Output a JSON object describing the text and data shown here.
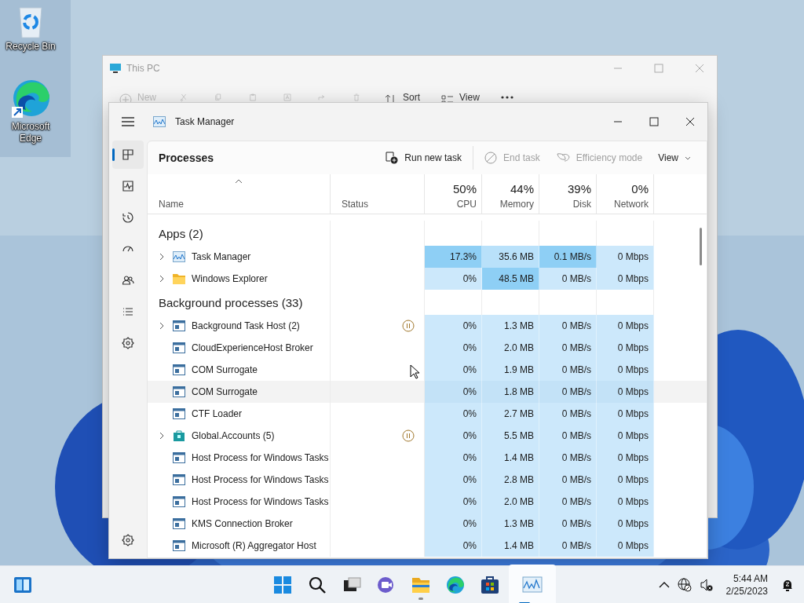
{
  "desktop_icons": [
    {
      "label": "Recycle Bin",
      "kind": "recycle"
    },
    {
      "label": "Microsoft Edge",
      "kind": "edge"
    }
  ],
  "explorer": {
    "title": "This PC",
    "toolbar": [
      {
        "kind": "new",
        "label": "New"
      },
      {
        "kind": "cut"
      },
      {
        "kind": "copy"
      },
      {
        "kind": "paste"
      },
      {
        "kind": "rename"
      },
      {
        "kind": "share"
      },
      {
        "kind": "delete"
      },
      {
        "kind": "sort",
        "label": "Sort"
      },
      {
        "kind": "view",
        "label": "View"
      }
    ]
  },
  "task_manager": {
    "title": "Task Manager",
    "nav": [
      {
        "kind": "processes",
        "selected": true
      },
      {
        "kind": "performance",
        "selected": false
      },
      {
        "kind": "history",
        "selected": false
      },
      {
        "kind": "startup",
        "selected": false
      },
      {
        "kind": "users",
        "selected": false
      },
      {
        "kind": "details",
        "selected": false
      },
      {
        "kind": "services",
        "selected": false
      }
    ],
    "page_title": "Processes",
    "actions": [
      {
        "kind": "run",
        "label": "Run new task",
        "disabled": false
      },
      {
        "kind": "end",
        "label": "End task",
        "disabled": true
      },
      {
        "kind": "efficiency",
        "label": "Efficiency mode",
        "disabled": true
      },
      {
        "kind": "menu",
        "label": "View",
        "disabled": false
      }
    ],
    "columns": [
      {
        "label": "Name",
        "sorted": true
      },
      {
        "label": "Status",
        "sorted": false
      },
      {
        "label": "CPU",
        "total": "50%",
        "sorted": false
      },
      {
        "label": "Memory",
        "total": "44%",
        "sorted": false
      },
      {
        "label": "Disk",
        "total": "39%",
        "sorted": false
      },
      {
        "label": "Network",
        "total": "0%",
        "sorted": false
      }
    ],
    "groups": [
      {
        "title": "Apps (2)",
        "rows": [
          {
            "name": "Task Manager",
            "kind": "chart",
            "expandable": true,
            "suspended": false,
            "hovered": false,
            "cells": [
              {
                "text": "17.3%",
                "color": "#8ecff5"
              },
              {
                "text": "35.6 MB",
                "color": "#b9e1fa"
              },
              {
                "text": "0.1 MB/s",
                "color": "#8ecff5"
              },
              {
                "text": "0 Mbps",
                "color": "#cce8fb"
              }
            ]
          },
          {
            "name": "Windows Explorer",
            "kind": "folder",
            "expandable": true,
            "suspended": false,
            "hovered": false,
            "cells": [
              {
                "text": "0%",
                "color": "#cce8fb"
              },
              {
                "text": "48.5 MB",
                "color": "#8ecff5"
              },
              {
                "text": "0 MB/s",
                "color": "#cce8fb"
              },
              {
                "text": "0 Mbps",
                "color": "#cce8fb"
              }
            ]
          }
        ]
      },
      {
        "title": "Background processes (33)",
        "rows": [
          {
            "name": "Background Task Host (2)",
            "kind": "window",
            "expandable": true,
            "suspended": true,
            "hovered": false,
            "cells": [
              {
                "text": "0%",
                "color": "#cce8fb"
              },
              {
                "text": "1.3 MB",
                "color": "#cce8fb"
              },
              {
                "text": "0 MB/s",
                "color": "#cce8fb"
              },
              {
                "text": "0 Mbps",
                "color": "#cce8fb"
              }
            ]
          },
          {
            "name": "CloudExperienceHost Broker",
            "kind": "window",
            "expandable": false,
            "suspended": false,
            "hovered": false,
            "cells": [
              {
                "text": "0%",
                "color": "#cce8fb"
              },
              {
                "text": "2.0 MB",
                "color": "#cce8fb"
              },
              {
                "text": "0 MB/s",
                "color": "#cce8fb"
              },
              {
                "text": "0 Mbps",
                "color": "#cce8fb"
              }
            ]
          },
          {
            "name": "COM Surrogate",
            "kind": "window",
            "expandable": false,
            "suspended": false,
            "hovered": false,
            "cells": [
              {
                "text": "0%",
                "color": "#cce8fb"
              },
              {
                "text": "1.9 MB",
                "color": "#cce8fb"
              },
              {
                "text": "0 MB/s",
                "color": "#cce8fb"
              },
              {
                "text": "0 Mbps",
                "color": "#cce8fb"
              }
            ]
          },
          {
            "name": "COM Surrogate",
            "kind": "window",
            "expandable": false,
            "suspended": false,
            "hovered": true,
            "cells": [
              {
                "text": "0%",
                "color": "#c3e2f7"
              },
              {
                "text": "1.8 MB",
                "color": "#c3e2f7"
              },
              {
                "text": "0 MB/s",
                "color": "#c3e2f7"
              },
              {
                "text": "0 Mbps",
                "color": "#c3e2f7"
              }
            ]
          },
          {
            "name": "CTF Loader",
            "kind": "window",
            "expandable": false,
            "suspended": false,
            "hovered": false,
            "cells": [
              {
                "text": "0%",
                "color": "#cce8fb"
              },
              {
                "text": "2.7 MB",
                "color": "#cce8fb"
              },
              {
                "text": "0 MB/s",
                "color": "#cce8fb"
              },
              {
                "text": "0 Mbps",
                "color": "#cce8fb"
              }
            ]
          },
          {
            "name": "Global.Accounts (5)",
            "kind": "store",
            "expandable": true,
            "suspended": true,
            "hovered": false,
            "cells": [
              {
                "text": "0%",
                "color": "#cce8fb"
              },
              {
                "text": "5.5 MB",
                "color": "#cce8fb"
              },
              {
                "text": "0 MB/s",
                "color": "#cce8fb"
              },
              {
                "text": "0 Mbps",
                "color": "#cce8fb"
              }
            ]
          },
          {
            "name": "Host Process for Windows Tasks",
            "kind": "window",
            "expandable": false,
            "suspended": false,
            "hovered": false,
            "cells": [
              {
                "text": "0%",
                "color": "#cce8fb"
              },
              {
                "text": "1.4 MB",
                "color": "#cce8fb"
              },
              {
                "text": "0 MB/s",
                "color": "#cce8fb"
              },
              {
                "text": "0 Mbps",
                "color": "#cce8fb"
              }
            ]
          },
          {
            "name": "Host Process for Windows Tasks",
            "kind": "window",
            "expandable": false,
            "suspended": false,
            "hovered": false,
            "cells": [
              {
                "text": "0%",
                "color": "#cce8fb"
              },
              {
                "text": "2.8 MB",
                "color": "#cce8fb"
              },
              {
                "text": "0 MB/s",
                "color": "#cce8fb"
              },
              {
                "text": "0 Mbps",
                "color": "#cce8fb"
              }
            ]
          },
          {
            "name": "Host Process for Windows Tasks",
            "kind": "window",
            "expandable": false,
            "suspended": false,
            "hovered": false,
            "cells": [
              {
                "text": "0%",
                "color": "#cce8fb"
              },
              {
                "text": "2.0 MB",
                "color": "#cce8fb"
              },
              {
                "text": "0 MB/s",
                "color": "#cce8fb"
              },
              {
                "text": "0 Mbps",
                "color": "#cce8fb"
              }
            ]
          },
          {
            "name": "KMS Connection Broker",
            "kind": "window",
            "expandable": false,
            "suspended": false,
            "hovered": false,
            "cells": [
              {
                "text": "0%",
                "color": "#cce8fb"
              },
              {
                "text": "1.3 MB",
                "color": "#cce8fb"
              },
              {
                "text": "0 MB/s",
                "color": "#cce8fb"
              },
              {
                "text": "0 Mbps",
                "color": "#cce8fb"
              }
            ]
          },
          {
            "name": "Microsoft (R) Aggregator Host",
            "kind": "window",
            "expandable": false,
            "suspended": false,
            "hovered": false,
            "cells": [
              {
                "text": "0%",
                "color": "#cce8fb"
              },
              {
                "text": "1.4 MB",
                "color": "#cce8fb"
              },
              {
                "text": "0 MB/s",
                "color": "#cce8fb"
              },
              {
                "text": "0 Mbps",
                "color": "#cce8fb"
              }
            ]
          }
        ]
      }
    ]
  },
  "taskbar": {
    "items": [
      {
        "kind": "start",
        "running": false,
        "active": false
      },
      {
        "kind": "search",
        "running": false,
        "active": false
      },
      {
        "kind": "taskview",
        "running": false,
        "active": false
      },
      {
        "kind": "chat",
        "running": false,
        "active": false
      },
      {
        "kind": "explorer",
        "running": true,
        "active": false
      },
      {
        "kind": "edge",
        "running": false,
        "active": false
      },
      {
        "kind": "store",
        "running": false,
        "active": false
      },
      {
        "kind": "taskmanager",
        "running": true,
        "active": true
      }
    ],
    "time": "5:44 AM",
    "date": "2/25/2023"
  }
}
